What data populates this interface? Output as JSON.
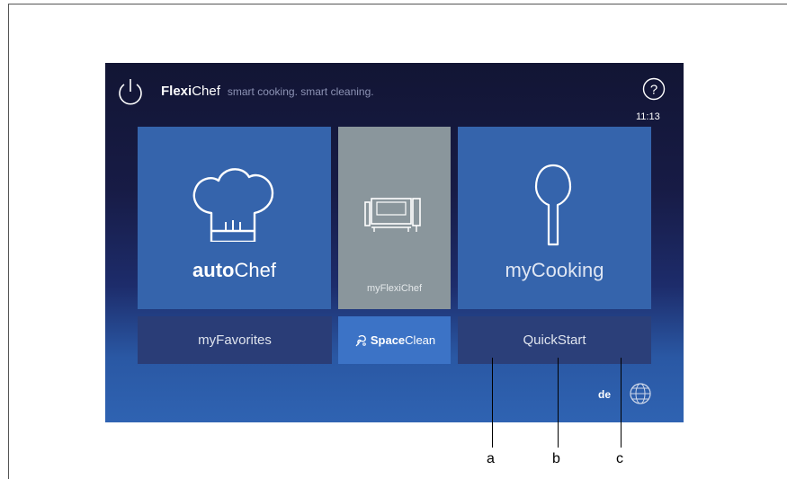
{
  "header": {
    "brand_bold": "Flexi",
    "brand_rest": "Chef",
    "tagline": "smart cooking. smart cleaning.",
    "clock": "11:13"
  },
  "tiles": {
    "auto_chef": {
      "label_bold": "auto",
      "label_rest": "Chef"
    },
    "my_flexichef": {
      "label": "myFlexiChef"
    },
    "my_cooking": {
      "label": "myCooking"
    },
    "my_favorites": {
      "label": "myFavorites"
    },
    "space_clean": {
      "label_bold": "Space",
      "label_rest": "Clean"
    },
    "quick_start": {
      "label": "QuickStart"
    }
  },
  "footer": {
    "language": "de"
  },
  "callouts": [
    "a",
    "b",
    "c"
  ],
  "colors": {
    "tile_blue": "#3564ac",
    "tile_gray": "#8a969c",
    "space_clean_blue": "#3c73c6"
  },
  "icons": [
    "power-icon",
    "help-icon",
    "chef-hat-icon",
    "oven-icon",
    "spoon-icon",
    "space-clean-icon",
    "globe-icon"
  ]
}
